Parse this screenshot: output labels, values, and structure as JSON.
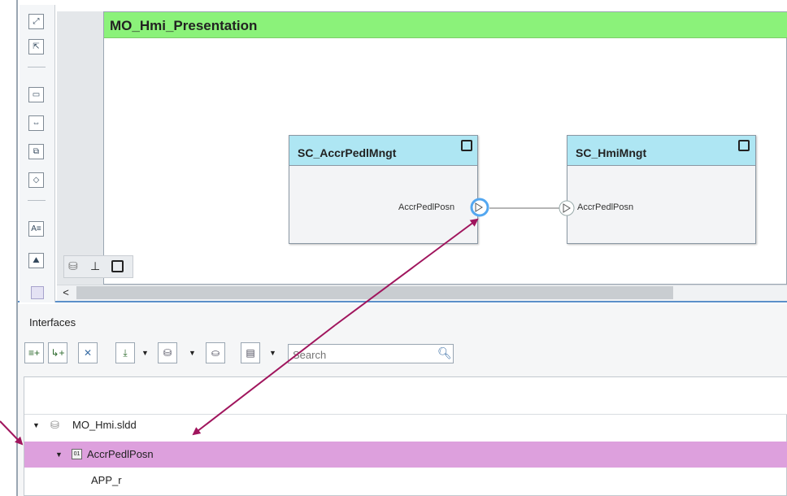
{
  "model": {
    "title": "MO_Hmi_Presentation"
  },
  "components": [
    {
      "name": "SC_AccrPedlMngt",
      "port_label": "AccrPedlPosn"
    },
    {
      "name": "SC_HmiMngt",
      "port_label": "AccrPedlPosn"
    }
  ],
  "palette": {
    "icons": [
      "fit-view-icon",
      "zoom-icon",
      "component-icon",
      "port-icon",
      "reference-icon",
      "adapter-icon",
      "text-annotation-icon",
      "image-icon"
    ]
  },
  "canvas_tools": {
    "icons": [
      "data-icon",
      "hierarchy-icon",
      "square-icon"
    ]
  },
  "scroll": {
    "left_arrow": "<"
  },
  "interfaces": {
    "title": "Interfaces",
    "search": {
      "placeholder": "Search"
    },
    "tree": [
      {
        "label": "MO_Hmi.sldd",
        "expanded": true,
        "level": 0
      },
      {
        "label": "AccrPedlPosn",
        "expanded": true,
        "level": 1,
        "selected": true
      },
      {
        "label": "APP_r",
        "level": 2
      }
    ]
  },
  "colors": {
    "model_title_bg": "#8bf27a",
    "component_header_bg": "#aee6f3",
    "selection_bg": "#dda0dd",
    "annotation_arrow": "#a0155d"
  }
}
